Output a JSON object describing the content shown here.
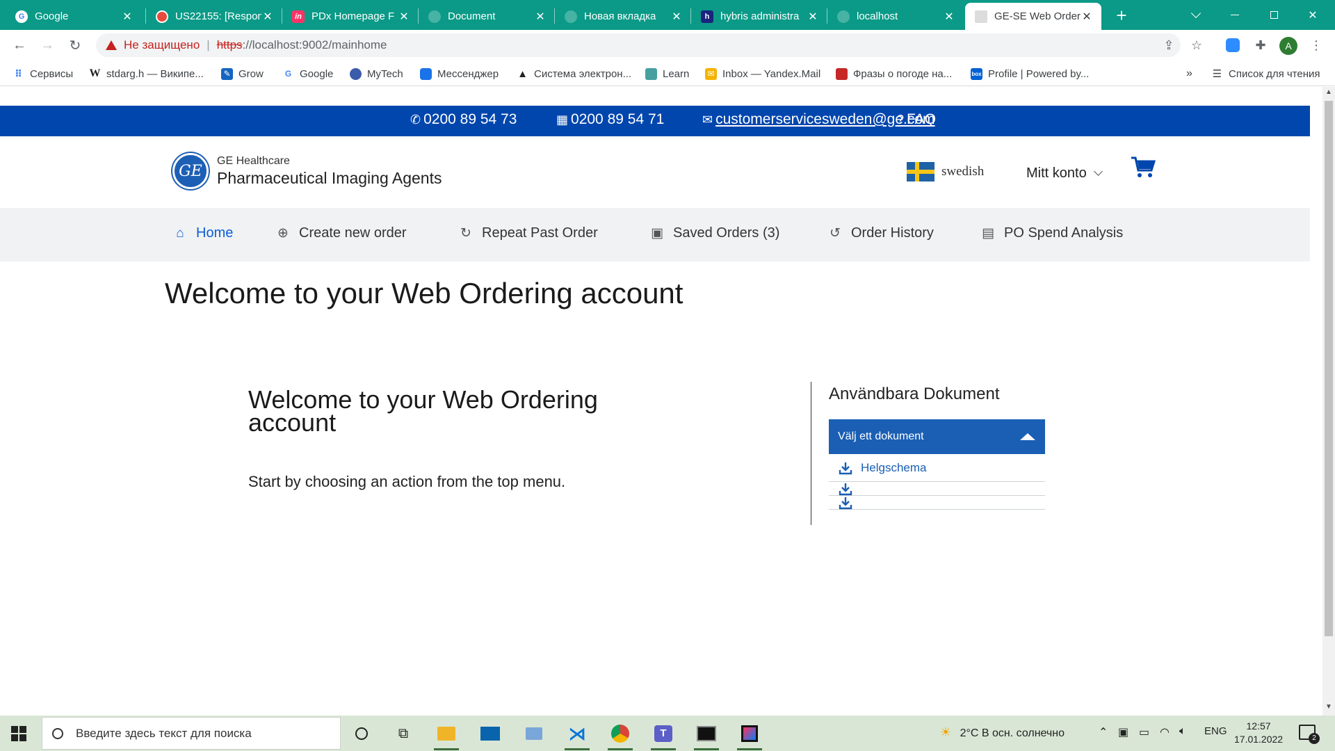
{
  "browser": {
    "tabs": [
      {
        "title": "Google",
        "favicon": "google-icon"
      },
      {
        "title": "US22155: [Respon",
        "favicon": "red-circle-icon"
      },
      {
        "title": "PDx Homepage F",
        "favicon": "invision-icon"
      },
      {
        "title": "Document",
        "favicon": "globe-icon"
      },
      {
        "title": "Новая вкладка",
        "favicon": "globe-icon"
      },
      {
        "title": "hybris administra",
        "favicon": "hybris-icon"
      },
      {
        "title": "localhost",
        "favicon": "globe-icon"
      },
      {
        "title": "GE-SE Web Order",
        "favicon": "ge-icon",
        "active": true
      }
    ],
    "address": {
      "security_label": "Не защищено",
      "url_scheme": "https",
      "url_rest": "://localhost:9002/mainhome"
    },
    "bookmarks": [
      {
        "label": "Сервисы",
        "icon": "apps-grid-icon"
      },
      {
        "label": "stdarg.h — Википе...",
        "icon": "wikipedia-icon"
      },
      {
        "label": "Grow",
        "icon": "grow-icon"
      },
      {
        "label": "Google",
        "icon": "google-icon"
      },
      {
        "label": "MyTech",
        "icon": "ge-icon"
      },
      {
        "label": "Мессенджер",
        "icon": "messenger-icon"
      },
      {
        "label": "Система электрон...",
        "icon": "graduation-cap-icon"
      },
      {
        "label": "Learn",
        "icon": "learn-icon"
      },
      {
        "label": "Inbox — Yandex.Mail",
        "icon": "mail-icon"
      },
      {
        "label": "Фразы о погоде на...",
        "icon": "flag-icon"
      },
      {
        "label": "Profile | Powered by...",
        "icon": "box-icon"
      }
    ],
    "reading_list": "Список для чтения",
    "avatar_letter": "A"
  },
  "site": {
    "contact": {
      "phone": "0200 89 54 73",
      "fax": "0200 89 54 71",
      "email": "customerservicesweden@ge.com",
      "faq": "FAQ"
    },
    "brand": {
      "line1": "GE Healthcare",
      "line2": "Pharmaceutical Imaging Agents",
      "logo_text": "GE"
    },
    "language": "swedish",
    "account_label": "Mitt konto",
    "nav": [
      {
        "label": "Home",
        "icon": "home-icon",
        "active": true
      },
      {
        "label": "Create new order",
        "icon": "plus-circle-icon"
      },
      {
        "label": "Repeat Past Order",
        "icon": "refresh-icon"
      },
      {
        "label": "Saved Orders (3)",
        "icon": "save-icon"
      },
      {
        "label": "Order History",
        "icon": "history-icon"
      },
      {
        "label": "PO Spend Analysis",
        "icon": "document-icon"
      }
    ],
    "page_title": "Welcome to your Web Ordering account",
    "welcome": {
      "heading": "Welcome to your Web Ordering account",
      "text": "Start by choosing an action from the top menu."
    },
    "documents": {
      "title": "Användbara Dokument",
      "select_label": "Välj ett dokument",
      "items": [
        "Helgschema",
        "",
        ""
      ]
    }
  },
  "taskbar": {
    "search_placeholder": "Введите здесь текст для поиска",
    "weather": "2°C  В осн. солнечно",
    "language": "ENG",
    "time": "12:57",
    "date": "17.01.2022",
    "notifications_count": "2"
  },
  "colors": {
    "chrome_tabstrip": "#0a9a87",
    "site_blue": "#0046ad",
    "nav_active": "#0b5ed7",
    "doc_select": "#1a5fb4"
  }
}
